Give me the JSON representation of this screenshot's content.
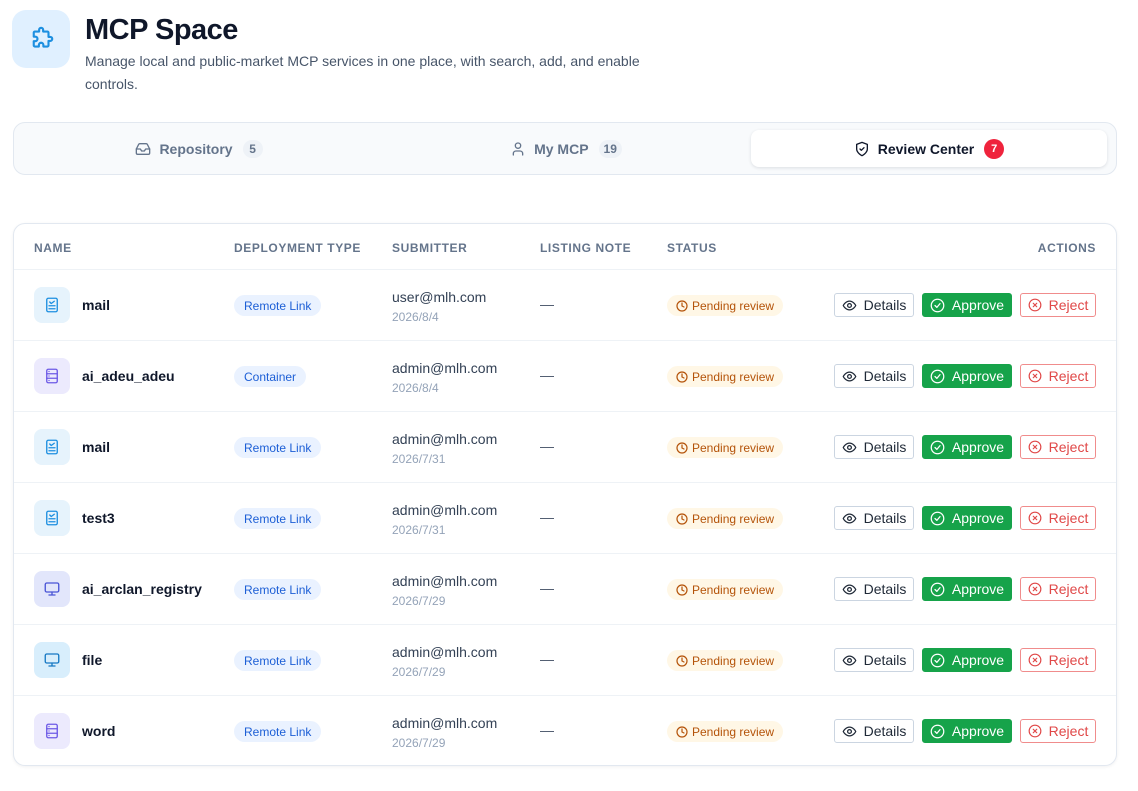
{
  "header": {
    "title": "MCP Space",
    "subtitle": "Manage local and public-market MCP services in one place, with search, add, and enable controls.",
    "logo_icon": "puzzle-icon"
  },
  "tabs": [
    {
      "label": "Repository",
      "count": "5",
      "icon": "inbox-icon",
      "active": false
    },
    {
      "label": "My MCP",
      "count": "19",
      "icon": "user-icon",
      "active": false
    },
    {
      "label": "Review Center",
      "count": "7",
      "icon": "shield-icon",
      "active": true
    }
  ],
  "table": {
    "columns": [
      "Name",
      "Deployment Type",
      "Submitter",
      "Listing Note",
      "Status",
      "Actions"
    ],
    "rows": [
      {
        "name": "mail",
        "icon": "doc-icon",
        "type": "Remote Link",
        "email": "user@mlh.com",
        "date": "2026/8/4",
        "note": "—",
        "status": "Pending review"
      },
      {
        "name": "ai_adeu_adeu",
        "icon": "server-icon",
        "type": "Container",
        "email": "admin@mlh.com",
        "date": "2026/8/4",
        "note": "—",
        "status": "Pending review"
      },
      {
        "name": "mail",
        "icon": "doc-icon",
        "type": "Remote Link",
        "email": "admin@mlh.com",
        "date": "2026/7/31",
        "note": "—",
        "status": "Pending review"
      },
      {
        "name": "test3",
        "icon": "doc-icon",
        "type": "Remote Link",
        "email": "admin@mlh.com",
        "date": "2026/7/31",
        "note": "—",
        "status": "Pending review"
      },
      {
        "name": "ai_arclan_registry",
        "icon": "monitor-icon",
        "type": "Remote Link",
        "email": "admin@mlh.com",
        "date": "2026/7/29",
        "note": "—",
        "status": "Pending review"
      },
      {
        "name": "file",
        "icon": "monitor-icon",
        "type": "Remote Link",
        "email": "admin@mlh.com",
        "date": "2026/7/29",
        "note": "—",
        "status": "Pending review"
      },
      {
        "name": "word",
        "icon": "server-icon",
        "type": "Remote Link",
        "email": "admin@mlh.com",
        "date": "2026/7/29",
        "note": "—",
        "status": "Pending review"
      }
    ],
    "actions": {
      "details": "Details",
      "approve": "Approve",
      "reject": "Reject"
    }
  },
  "colors": {
    "accent": "#1d8fe0",
    "approve": "#16a34a",
    "reject": "#e04848",
    "pending": "#b45309",
    "badge": "#ef233c"
  }
}
